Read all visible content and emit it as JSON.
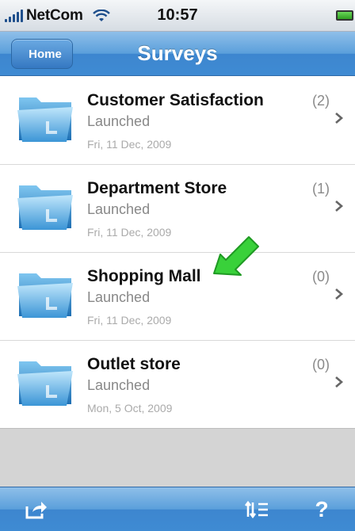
{
  "status_bar": {
    "carrier": "NetCom",
    "time": "10:57"
  },
  "nav": {
    "back_label": "Home",
    "title": "Surveys"
  },
  "surveys": [
    {
      "title": "Customer Satisfaction",
      "status": "Launched",
      "date": "Fri, 11 Dec, 2009",
      "count": "(2)"
    },
    {
      "title": "Department Store",
      "status": "Launched",
      "date": "Fri, 11 Dec, 2009",
      "count": "(1)"
    },
    {
      "title": "Shopping Mall",
      "status": "Launched",
      "date": "Fri, 11 Dec, 2009",
      "count": "(0)"
    },
    {
      "title": "Outlet store",
      "status": "Launched",
      "date": "Mon, 5 Oct, 2009",
      "count": "(0)"
    }
  ],
  "toolbar": {
    "share_icon": "share-icon",
    "sort_icon": "sort-icon",
    "help_label": "?"
  },
  "colors": {
    "accent": "#4a90d9",
    "arrow": "#39d13a"
  }
}
